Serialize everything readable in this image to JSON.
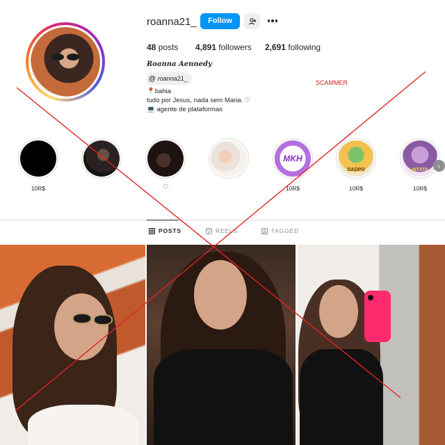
{
  "profile": {
    "username": "roanna21_",
    "follow_label": "Follow",
    "stats": {
      "posts_value": "48",
      "posts_label": "posts",
      "followers_value": "4,891",
      "followers_label": "followers",
      "following_value": "2,691",
      "following_label": "following"
    },
    "full_name": "Roanna Aennedy",
    "threads_handle": "roanna21_",
    "bio": [
      "📍bahia",
      "tudo por Jesus, nada sem Maria. ♡",
      "💻 agente de plataformas"
    ]
  },
  "annotation": {
    "scammer_text": "SCAMMER",
    "cross_color": "#e02424"
  },
  "highlights": [
    {
      "label": "10R$",
      "style": "black"
    },
    {
      "label": "",
      "style": "selfie-dark"
    },
    {
      "label": "",
      "style": "dark-room",
      "heart": "♡"
    },
    {
      "label": "",
      "style": "baby"
    },
    {
      "label": "10R$",
      "style": "mkh-logo",
      "logo_text": "MKH"
    },
    {
      "label": "10R$",
      "style": "dragon-logo",
      "logo_text": "DADPO"
    },
    {
      "label": "10R$",
      "style": "leopard-logo",
      "logo_text": "HITATA"
    }
  ],
  "tabs": [
    {
      "label": "POSTS",
      "active": true,
      "icon": "grid-icon"
    },
    {
      "label": "REELS",
      "active": false,
      "icon": "reels-icon"
    },
    {
      "label": "TAGGED",
      "active": false,
      "icon": "tagged-icon"
    }
  ],
  "colors": {
    "accent": "#0095f6",
    "text": "#262626",
    "muted": "#8e8e8e"
  }
}
